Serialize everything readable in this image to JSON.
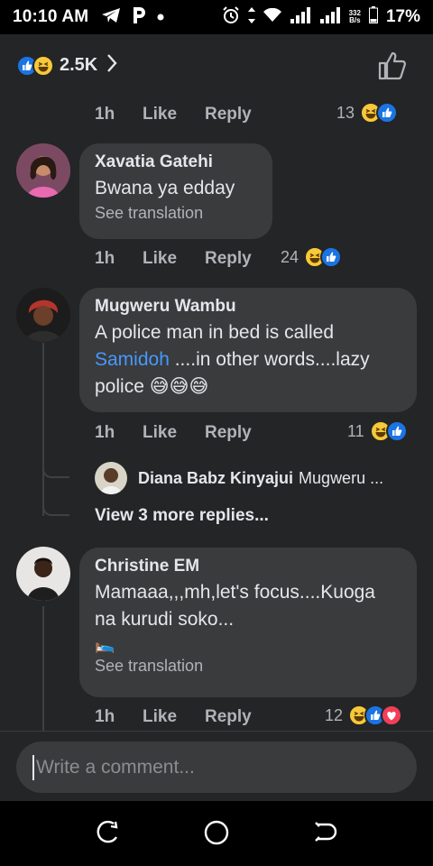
{
  "status_bar": {
    "time": "10:10 AM",
    "speed_value": "332",
    "speed_unit": "B/s",
    "battery": "17%",
    "icons": [
      "telegram-icon",
      "p-app-icon",
      "dot-icon",
      "alarm-icon",
      "data-arrows-icon",
      "wifi-icon",
      "signal-icon",
      "signal-icon-2",
      "battery-icon"
    ]
  },
  "header": {
    "reaction_count": "2.5K",
    "reactions": [
      "like",
      "haha"
    ]
  },
  "top_actions": {
    "time": "1h",
    "like": "Like",
    "reply": "Reply",
    "reaction_count": "13"
  },
  "comments": [
    {
      "author": "Xavatia Gatehi",
      "text": "Bwana ya edday",
      "see_translation": "See translation",
      "time": "1h",
      "like": "Like",
      "reply": "Reply",
      "reaction_count": "24"
    },
    {
      "author": "Mugweru Wambu",
      "text_before": "A police man in bed is called ",
      "mention": "Samidoh",
      "text_after": " ....in other words....lazy police 😅😅😅",
      "time": "1h",
      "like": "Like",
      "reply": "Reply",
      "reaction_count": "11",
      "reply_preview": {
        "author": "Diana Babz Kinyajui",
        "snippet": "Mugweru ..."
      },
      "more_replies": "View 3 more replies..."
    },
    {
      "author": "Christine EM",
      "text": "Mamaaa,,,mh,let's focus....Kuoga na kurudi soko...",
      "emoji_line": "🛌",
      "see_translation": "See translation",
      "time": "1h",
      "like": "Like",
      "reply": "Reply",
      "reaction_count": "12"
    }
  ],
  "composer": {
    "placeholder": "Write a comment..."
  },
  "colors": {
    "background": "#242526",
    "bubble": "#3a3b3c",
    "accent_link": "#4599ff",
    "like_blue": "#1b74e4",
    "haha_yellow": "#f7c93a",
    "love_red": "#f33e58"
  }
}
